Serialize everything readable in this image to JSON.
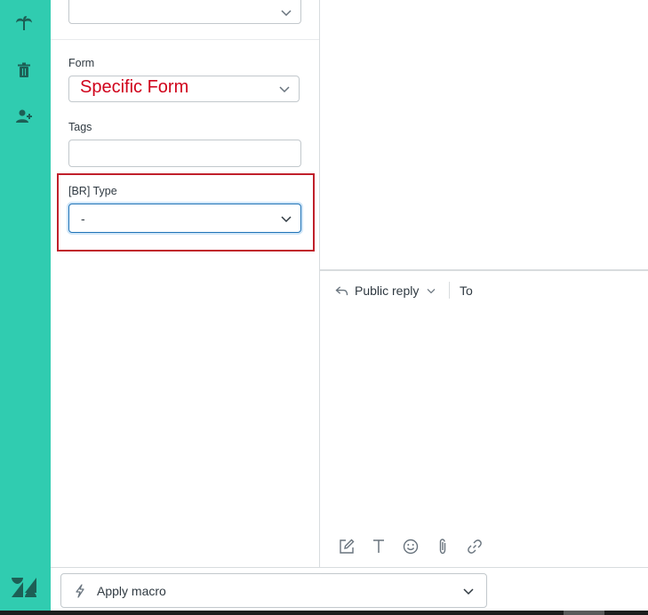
{
  "rail": {
    "icons": [
      "palm-tree-icon",
      "trash-icon",
      "add-user-icon"
    ],
    "logo": "zendesk-logo"
  },
  "fields": {
    "form": {
      "label": "Form",
      "value": "Specific Form"
    },
    "tags": {
      "label": "Tags",
      "value": ""
    },
    "br_type": {
      "label": "[BR] Type",
      "value": "-"
    }
  },
  "composer": {
    "reply_mode": "Public reply",
    "to_label": "To",
    "toolbar": [
      "compose-icon",
      "text-format-icon",
      "emoji-icon",
      "attachment-icon",
      "link-icon"
    ]
  },
  "footer": {
    "macro_label": "Apply macro"
  },
  "colors": {
    "rail": "#30ccb0",
    "highlight_box": "#c0202b",
    "annotation_text": "#d0021b",
    "focus_border": "#1f73b7"
  }
}
